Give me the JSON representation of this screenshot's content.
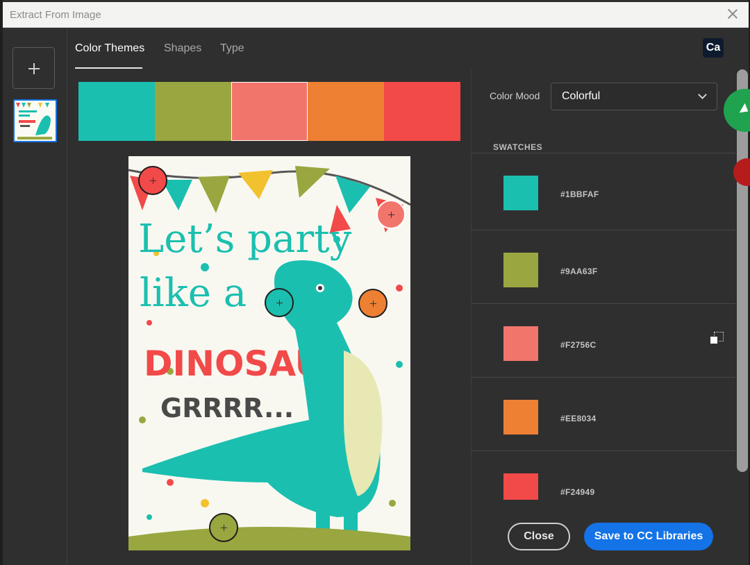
{
  "window": {
    "title": "Extract From Image",
    "badge": "Ca"
  },
  "tabs": [
    {
      "label": "Color Themes",
      "active": true
    },
    {
      "label": "Shapes",
      "active": false
    },
    {
      "label": "Type",
      "active": false
    }
  ],
  "theme_colors": [
    "#1BBFAF",
    "#9AA63F",
    "#F2756C",
    "#EE8034",
    "#F24949"
  ],
  "selected_theme_index": 2,
  "color_mood": {
    "label": "Color Mood",
    "value": "Colorful"
  },
  "swatches": {
    "heading": "SWATCHES",
    "items": [
      {
        "hex": "#1BBFAF"
      },
      {
        "hex": "#9AA63F"
      },
      {
        "hex": "#F2756C"
      },
      {
        "hex": "#EE8034"
      },
      {
        "hex": "#F24949"
      }
    ]
  },
  "poster": {
    "line1": "Let’s party",
    "line2": "like a",
    "line3": "DINOSAUR",
    "line4": "GRRRR..."
  },
  "buttons": {
    "close": "Close",
    "save": "Save to CC Libraries"
  }
}
